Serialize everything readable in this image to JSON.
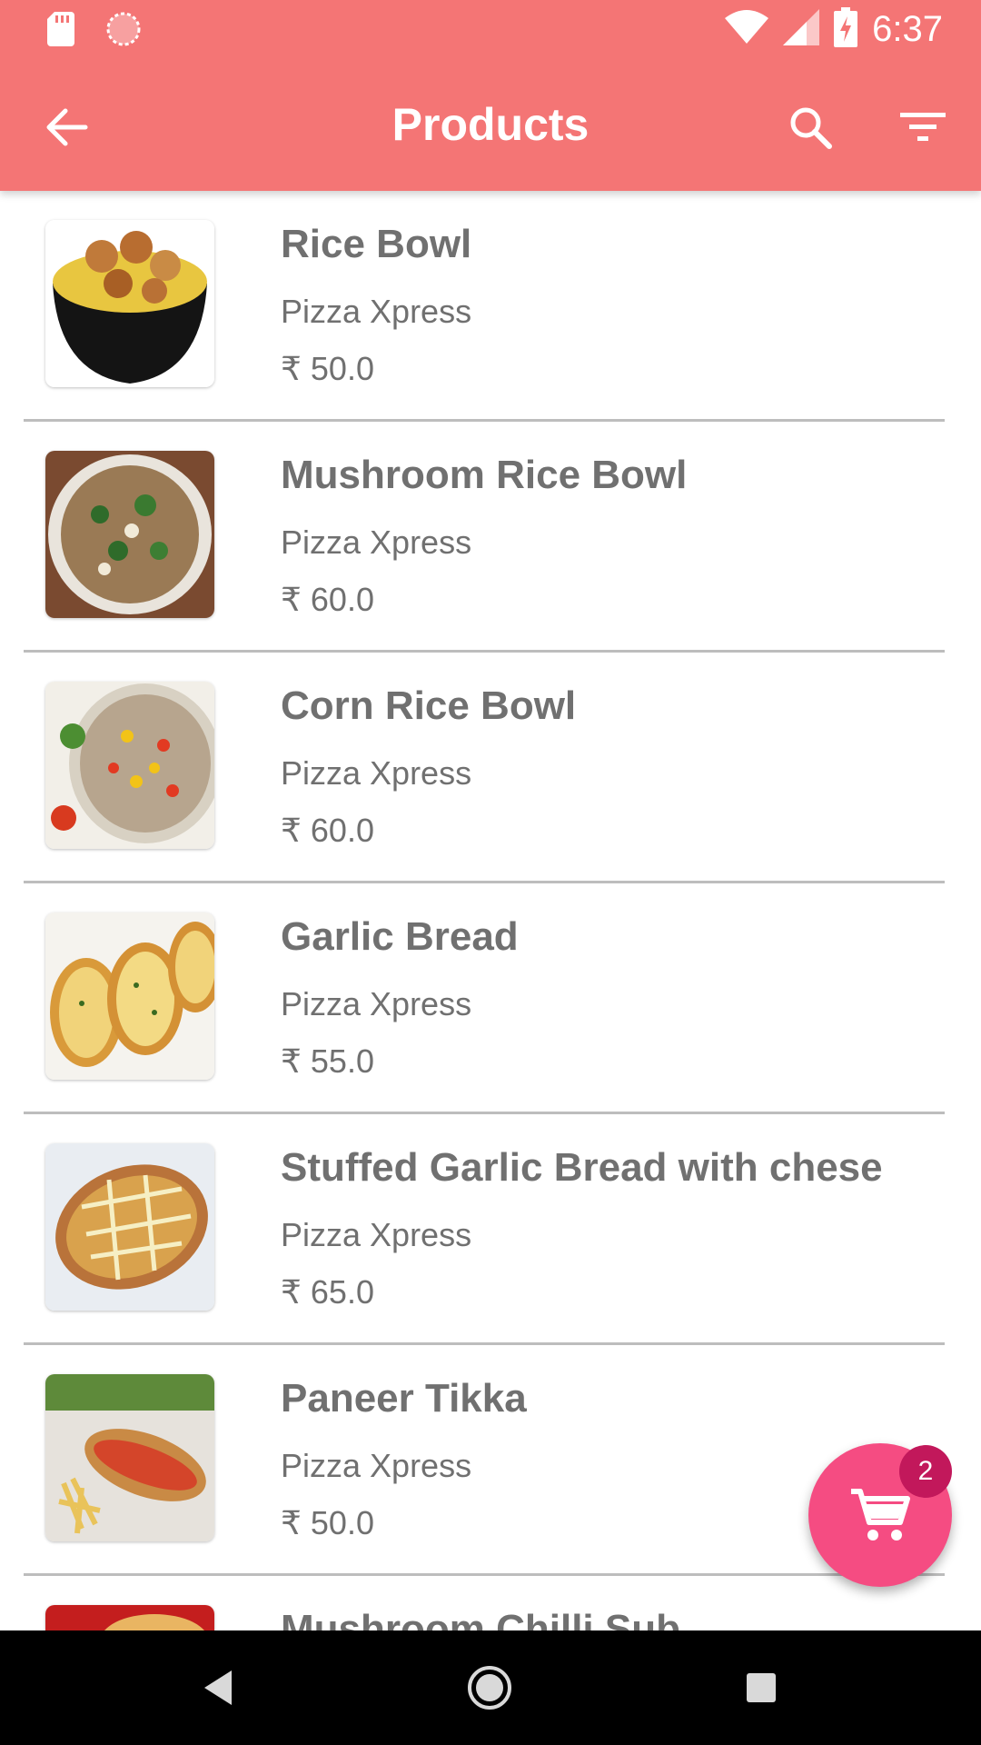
{
  "status_bar": {
    "time": "6:37",
    "left_icons": [
      "sd-card-icon",
      "sync-icon"
    ],
    "right_icons": [
      "wifi-icon",
      "signal-icon",
      "battery-charging-icon"
    ]
  },
  "toolbar": {
    "title": "Products",
    "back_icon": "arrow-left-icon",
    "search_icon": "search-icon",
    "filter_icon": "filter-icon",
    "background_color": "#f47575"
  },
  "products": [
    {
      "name": "Rice Bowl",
      "restaurant": "Pizza Xpress",
      "price": "₹ 50.0"
    },
    {
      "name": "Mushroom Rice Bowl",
      "restaurant": "Pizza Xpress",
      "price": "₹ 60.0"
    },
    {
      "name": "Corn Rice Bowl",
      "restaurant": "Pizza Xpress",
      "price": "₹ 60.0"
    },
    {
      "name": "Garlic Bread",
      "restaurant": "Pizza Xpress",
      "price": "₹ 55.0"
    },
    {
      "name": "Stuffed Garlic Bread with chese",
      "restaurant": "Pizza Xpress",
      "price": "₹ 65.0"
    },
    {
      "name": "Paneer Tikka",
      "restaurant": "Pizza Xpress",
      "price": "₹ 50.0"
    },
    {
      "name": "Mushroom Chilli Sub",
      "restaurant": "",
      "price": ""
    }
  ],
  "cart": {
    "icon": "cart-icon",
    "count": "2",
    "fab_color": "#f54c82"
  },
  "nav_bar": {
    "icons": [
      "back-triangle-icon",
      "home-circle-icon",
      "recents-square-icon"
    ]
  }
}
